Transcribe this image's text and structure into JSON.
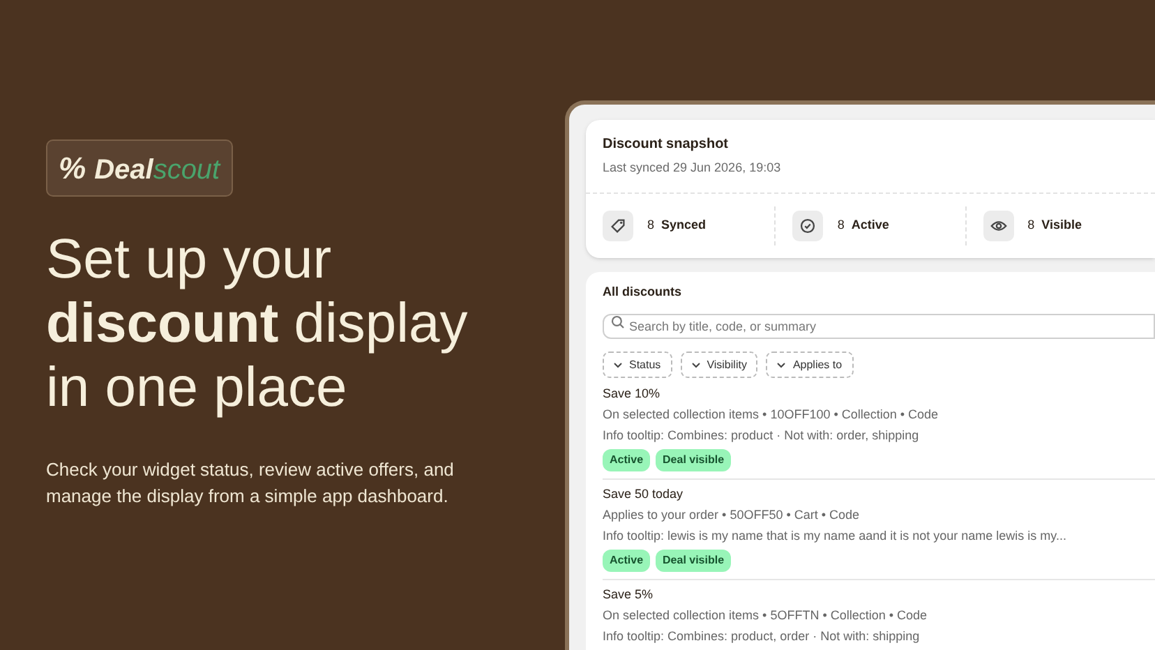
{
  "logo": {
    "mark": "%",
    "word_1": "Deal",
    "word_2": "scout"
  },
  "headline": [
    "Set up your",
    "**discount** display",
    "in one place"
  ],
  "description": "Check your widget status, review active offers, and manage the display from a simple app dashboard.",
  "snapshot": {
    "title": "Discount snapshot",
    "subtitle": "Last synced 29 Jun 2026, 19:03",
    "stats": [
      {
        "kind": "tag",
        "count": "8",
        "label": "Synced"
      },
      {
        "kind": "check",
        "count": "8",
        "label": "Active"
      },
      {
        "kind": "eye",
        "count": "8",
        "label": "Visible"
      }
    ]
  },
  "discounts": {
    "title": "All discounts",
    "search": {
      "placeholder": "Search by title, code, or summary"
    },
    "filters": [
      "Status",
      "Visibility",
      "Applies to"
    ],
    "rows": [
      {
        "title": "Save 10%",
        "summary": "On selected collection items • 10OFF100 • Collection • Code",
        "info": "Info tooltip: Combines: product · Not with: order, shipping",
        "badges": [
          "Active",
          "Deal visible"
        ]
      },
      {
        "title": "Save 50 today",
        "summary": "Applies to your order • 50OFF50 • Cart • Code",
        "info": "Info tooltip: lewis is my name that is my name aand it is not your name lewis is my...",
        "badges": [
          "Active",
          "Deal visible"
        ]
      },
      {
        "title": "Save 5%",
        "summary": "On selected collection items • 5OFFTN • Collection • Code",
        "info": "Info tooltip: Combines: product, order · Not with: shipping",
        "badges": []
      }
    ]
  }
}
